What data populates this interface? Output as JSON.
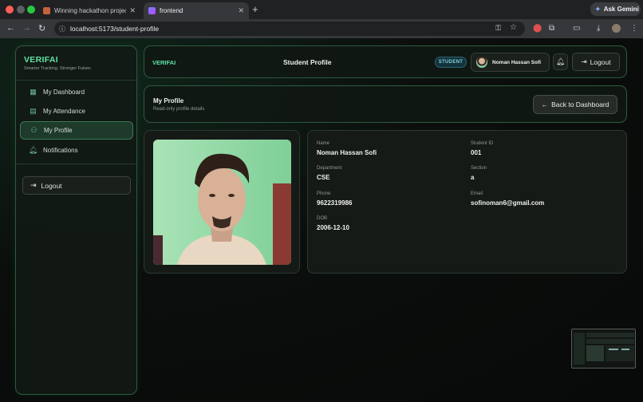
{
  "browser": {
    "tabs": [
      {
        "title": "Winning hackathon project st",
        "active": false
      },
      {
        "title": "frontend",
        "active": true
      }
    ],
    "url": "localhost:5173/student-profile",
    "gemini_label": "Ask Gemini"
  },
  "sidebar": {
    "brand": "VERIFAI",
    "tagline": "Smarter Tracking. Stronger Future.",
    "items": [
      {
        "label": "My Dashboard",
        "icon": "grid-icon",
        "active": false
      },
      {
        "label": "My Attendance",
        "icon": "clipboard-icon",
        "active": false
      },
      {
        "label": "My Profile",
        "icon": "user-icon",
        "active": true
      },
      {
        "label": "Notifications",
        "icon": "bell-icon",
        "active": false
      }
    ],
    "logout_label": "Logout"
  },
  "topbar": {
    "brand": "VERIFAI",
    "title": "Student Profile",
    "role_badge": "STUDENT",
    "user_name": "Noman Hassan Sofi",
    "logout_label": "Logout"
  },
  "header": {
    "title": "My Profile",
    "subtitle": "Read-only profile details",
    "back_label": "Back to Dashboard"
  },
  "profile": {
    "name_label": "Name",
    "name": "Noman Hassan Sofi",
    "student_id_label": "Student ID",
    "student_id": "001",
    "department_label": "Department",
    "department": "CSE",
    "section_label": "Section",
    "section": "a",
    "phone_label": "Phone",
    "phone": "9622319986",
    "email_label": "Email",
    "email": "sofinoman6@gmail.com",
    "dob_label": "DOB",
    "dob": "2006-12-10"
  },
  "colors": {
    "accent": "#5fe3a6",
    "border": "#2e5a3d",
    "badge": "#7fd0e4"
  }
}
